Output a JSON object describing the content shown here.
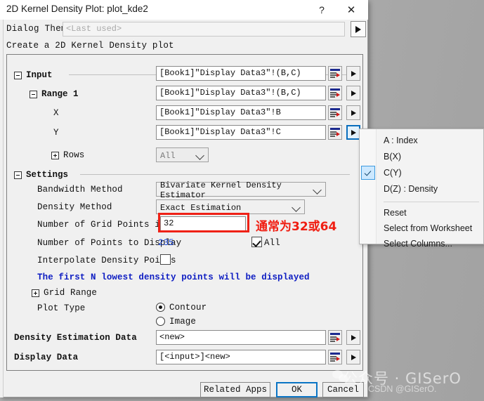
{
  "window": {
    "title": "2D Kernel Density Plot: plot_kde2",
    "help_icon": "?",
    "close_icon": "✕"
  },
  "theme": {
    "label": "Dialog Theme",
    "value": "<Last used>",
    "arrow_icon": "triangle-right-icon"
  },
  "description": "Create a 2D Kernel Density plot",
  "input_group": {
    "title": "Input",
    "expander": "collapse-icon",
    "value": "[Book1]\"Display Data3\"!(B,C)",
    "range1": {
      "title": "Range 1",
      "value": "[Book1]\"Display Data3\"!(B,C)"
    },
    "x": {
      "label": "X",
      "value": "[Book1]\"Display Data3\"!B"
    },
    "y": {
      "label": "Y",
      "value": "[Book1]\"Display Data3\"!C"
    },
    "rows": {
      "label": "Rows",
      "value": "All"
    }
  },
  "settings_group": {
    "title": "Settings",
    "bandwidth_method": {
      "label": "Bandwidth Method",
      "value": "Bivariate Kernel Density Estimator"
    },
    "density_method": {
      "label": "Density Method",
      "value": "Exact Estimation"
    },
    "grid_points": {
      "label": "Number of Grid Points in X/Y",
      "value": "32"
    },
    "points_to_display": {
      "label": "Number of Points to Display",
      "value": "235",
      "all_label": "All",
      "all_checked": true
    },
    "interpolate": {
      "label": "Interpolate Density Points",
      "checked": false
    },
    "note": "The first N lowest density points will be displayed",
    "grid_range": {
      "label": "Grid Range",
      "expander": "expand-icon"
    },
    "plot_type": {
      "label": "Plot Type",
      "options": [
        {
          "label": "Contour",
          "selected": true
        },
        {
          "label": "Image",
          "selected": false
        }
      ]
    }
  },
  "outputs": {
    "density_estimation_data": {
      "label": "Density Estimation Data",
      "value": "<new>"
    },
    "display_data": {
      "label": "Display Data",
      "value": "[<input>]<new>"
    }
  },
  "footer": {
    "related_apps": "Related Apps",
    "ok": "OK",
    "cancel": "Cancel"
  },
  "popup_menu": {
    "items": [
      {
        "label": "A : Index",
        "checked": false
      },
      {
        "label": "B(X)",
        "checked": false
      },
      {
        "label": "C(Y)",
        "checked": true
      },
      {
        "label": "D(Z) : Density",
        "checked": false
      },
      {
        "label": "Reset",
        "checked": false
      },
      {
        "label": "Select from Worksheet",
        "checked": false
      },
      {
        "label": "Select Columns...",
        "checked": false
      }
    ]
  },
  "annotation": {
    "text": "通常为32或64",
    "box_color": "#ef2116",
    "text_color": "#f01e12"
  },
  "watermark": {
    "cn": "公众号 · GISerO",
    "csdn": "CSDN @GISerO."
  },
  "colors": {
    "dialog_bg": "#f0f0f0",
    "desktop_bg": "#a9a9a9",
    "note_blue": "#0d1cc2",
    "value_blue": "#1a46d8",
    "focus_blue": "#0a6ebd"
  }
}
